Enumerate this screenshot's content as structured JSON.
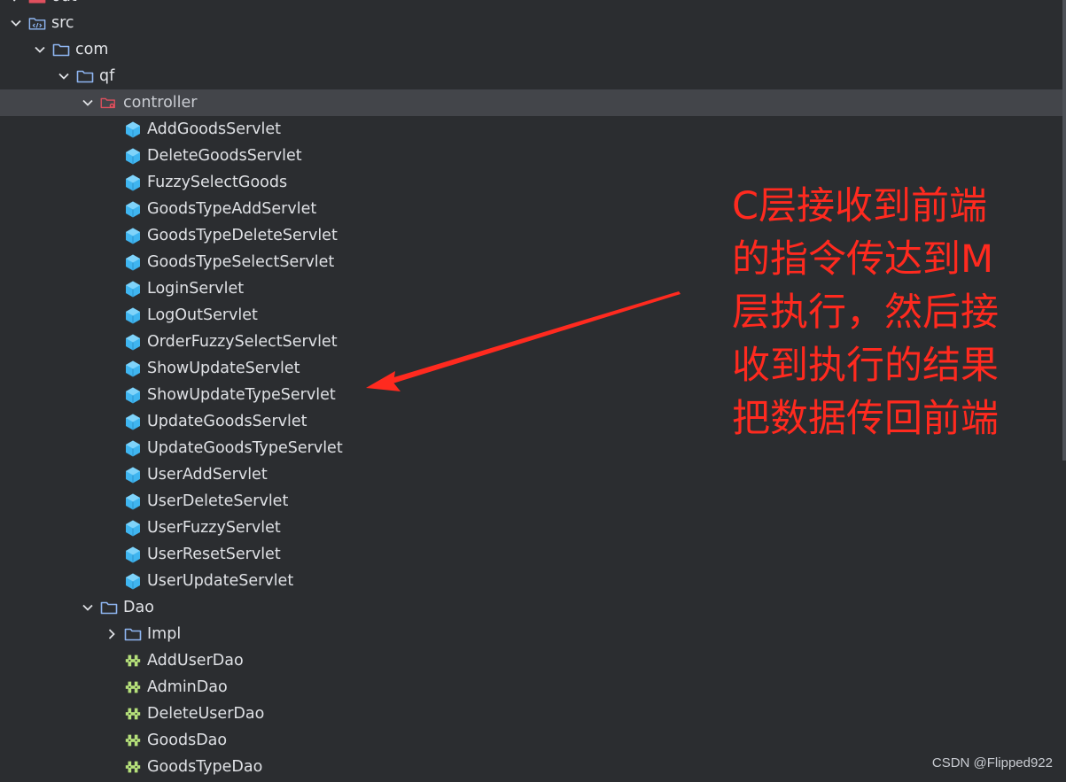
{
  "tree": [
    {
      "label": "out",
      "kind": "folder-out",
      "chevron": "right",
      "depth": 0
    },
    {
      "label": "src",
      "kind": "folder-src",
      "chevron": "down",
      "depth": 0
    },
    {
      "label": "com",
      "kind": "folder",
      "chevron": "down",
      "depth": 1
    },
    {
      "label": "qf",
      "kind": "folder",
      "chevron": "down",
      "depth": 2
    },
    {
      "label": "controller",
      "kind": "folder-controller",
      "chevron": "down",
      "depth": 3,
      "selected": true
    },
    {
      "label": "AddGoodsServlet",
      "kind": "class",
      "chevron": "",
      "depth": 4
    },
    {
      "label": "DeleteGoodsServlet",
      "kind": "class",
      "chevron": "",
      "depth": 4
    },
    {
      "label": "FuzzySelectGoods",
      "kind": "class",
      "chevron": "",
      "depth": 4
    },
    {
      "label": "GoodsTypeAddServlet",
      "kind": "class",
      "chevron": "",
      "depth": 4
    },
    {
      "label": "GoodsTypeDeleteServlet",
      "kind": "class",
      "chevron": "",
      "depth": 4
    },
    {
      "label": "GoodsTypeSelectServlet",
      "kind": "class",
      "chevron": "",
      "depth": 4
    },
    {
      "label": "LoginServlet",
      "kind": "class",
      "chevron": "",
      "depth": 4
    },
    {
      "label": "LogOutServlet",
      "kind": "class",
      "chevron": "",
      "depth": 4
    },
    {
      "label": "OrderFuzzySelectServlet",
      "kind": "class",
      "chevron": "",
      "depth": 4
    },
    {
      "label": "ShowUpdateServlet",
      "kind": "class",
      "chevron": "",
      "depth": 4
    },
    {
      "label": "ShowUpdateTypeServlet",
      "kind": "class",
      "chevron": "",
      "depth": 4
    },
    {
      "label": "UpdateGoodsServlet",
      "kind": "class",
      "chevron": "",
      "depth": 4
    },
    {
      "label": "UpdateGoodsTypeServlet",
      "kind": "class",
      "chevron": "",
      "depth": 4
    },
    {
      "label": "UserAddServlet",
      "kind": "class",
      "chevron": "",
      "depth": 4
    },
    {
      "label": "UserDeleteServlet",
      "kind": "class",
      "chevron": "",
      "depth": 4
    },
    {
      "label": "UserFuzzyServlet",
      "kind": "class",
      "chevron": "",
      "depth": 4
    },
    {
      "label": "UserResetServlet",
      "kind": "class",
      "chevron": "",
      "depth": 4
    },
    {
      "label": "UserUpdateServlet",
      "kind": "class",
      "chevron": "",
      "depth": 4
    },
    {
      "label": "Dao",
      "kind": "folder",
      "chevron": "down",
      "depth": 3
    },
    {
      "label": "Impl",
      "kind": "folder",
      "chevron": "right",
      "depth": 4
    },
    {
      "label": "AddUserDao",
      "kind": "interface",
      "chevron": "",
      "depth": 4
    },
    {
      "label": "AdminDao",
      "kind": "interface",
      "chevron": "",
      "depth": 4
    },
    {
      "label": "DeleteUserDao",
      "kind": "interface",
      "chevron": "",
      "depth": 4
    },
    {
      "label": "GoodsDao",
      "kind": "interface",
      "chevron": "",
      "depth": 4
    },
    {
      "label": "GoodsTypeDao",
      "kind": "interface",
      "chevron": "",
      "depth": 4
    }
  ],
  "annotation": {
    "lines": [
      "C层接收到前端",
      "的指令传达到M",
      "层执行，然后接",
      "收到执行的结果",
      "把数据传回前端"
    ],
    "color": "#ff2a1f"
  },
  "watermark": "CSDN @Flipped922",
  "colors": {
    "background": "#2b2d30",
    "selected_row": "#43454a",
    "folder": "#8fb6f2",
    "class_icon": "#3fb5f0",
    "interface_icon": "#b5e07a",
    "controller_icon": "#e0505e"
  }
}
